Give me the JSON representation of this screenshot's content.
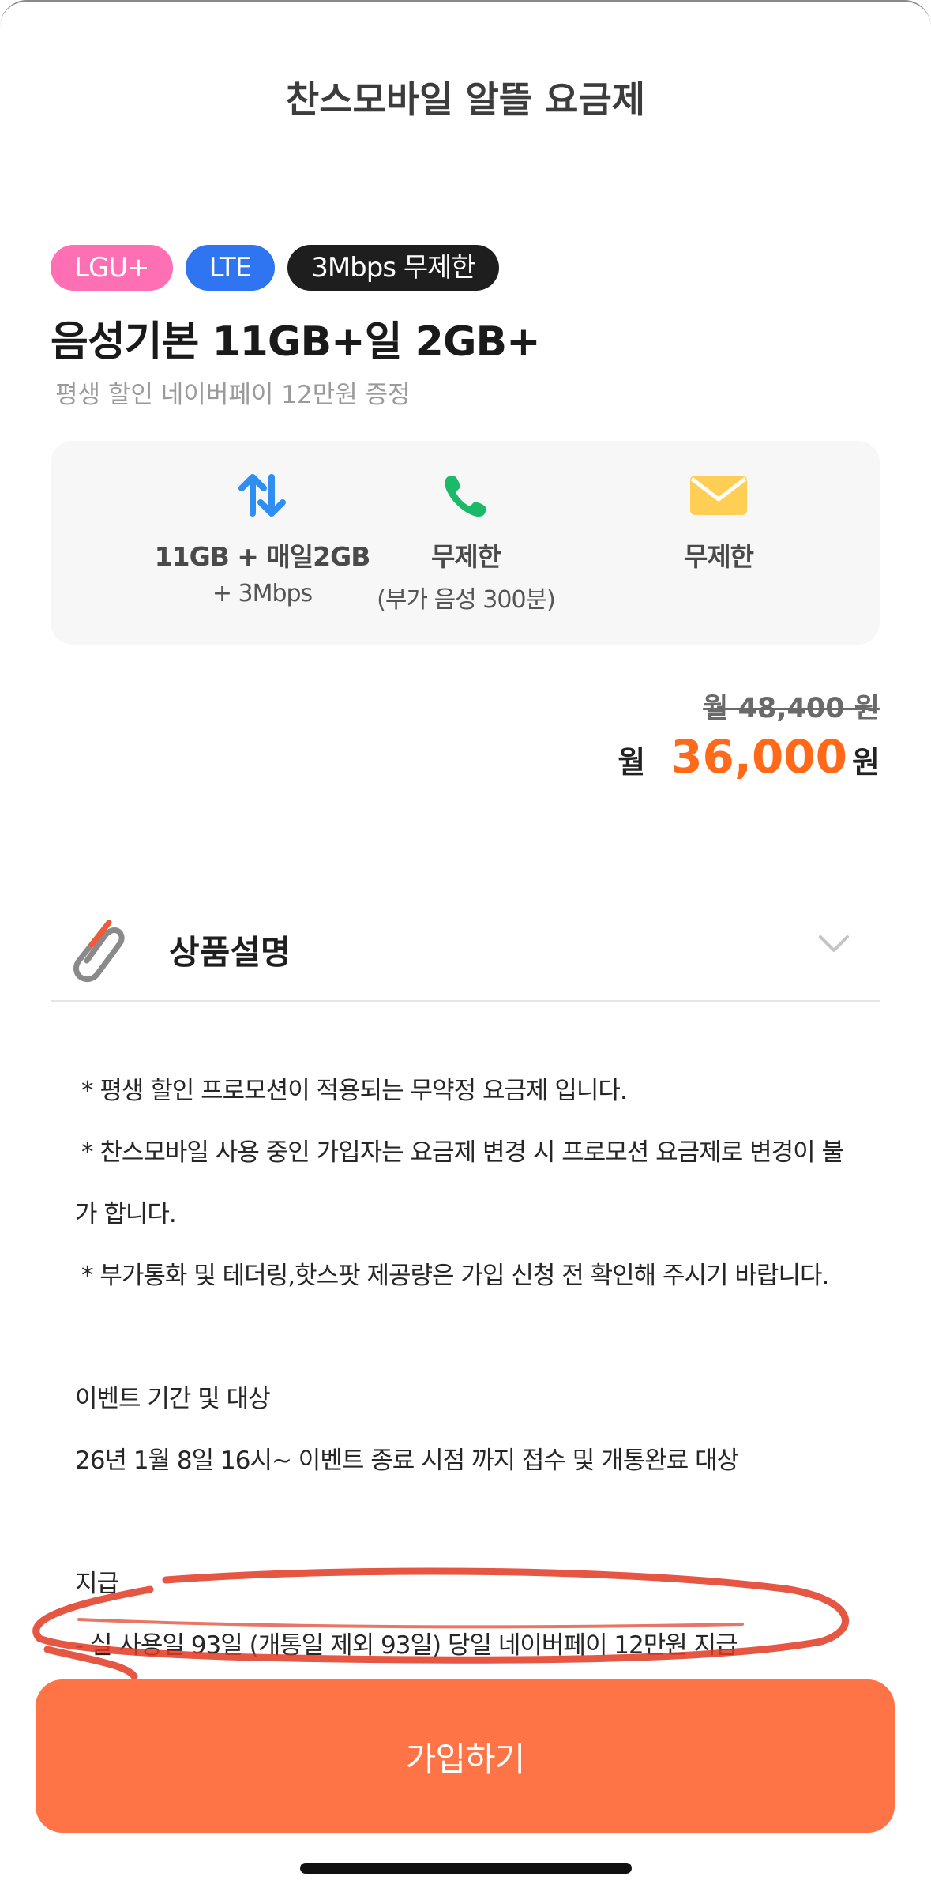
{
  "header": {
    "title": "찬스모바일 알뜰 요금제"
  },
  "tags": [
    {
      "label": "LGU+",
      "color": "#ff6fb4"
    },
    {
      "label": "LTE",
      "color": "#2f74f0"
    },
    {
      "label": "3Mbps 무제한",
      "color": "#1e1e1e"
    }
  ],
  "plan": {
    "name": "음성기본 11GB+일 2GB+",
    "subtitle": "평생 할인 네이버페이 12만원 증정"
  },
  "features": [
    {
      "icon": "data-transfer-icon",
      "main": "11GB + 매일2GB",
      "sub": "+ 3Mbps"
    },
    {
      "icon": "phone-icon",
      "main": "무제한",
      "sub": "(부가 음성 300분)"
    },
    {
      "icon": "mail-icon",
      "main": "무제한",
      "sub": ""
    }
  ],
  "price": {
    "original": "월 48,400 원",
    "prefix": "월",
    "current": "36,000",
    "unit": "원",
    "accent_color": "#ff6a1a"
  },
  "section": {
    "title": "상품설명"
  },
  "description": {
    "line1": "* 평생 할인 프로모션이 적용되는 무약정 요금제 입니다.",
    "line2": "* 찬스모바일 사용 중인 가입자는 요금제 변경 시 프로모션 요금제로 변경이 불",
    "line3": "가 합니다.",
    "line4": "* 부가통화 및 테더링,핫스팟 제공량은 가입 신청 전 확인해 주시기 바랍니다.",
    "line5": "이벤트 기간 및 대상",
    "line6": "26년 1월 8일 16시~ 이벤트 종료 시점 까지 접수 및 개통완료 대상",
    "line7": "지급",
    "line8": "- 실 사용일 93일 (개통일 제외 93일) 당일 네이버페이 12만원 지급"
  },
  "cta": {
    "label": "가입하기",
    "color": "#ff7446"
  }
}
